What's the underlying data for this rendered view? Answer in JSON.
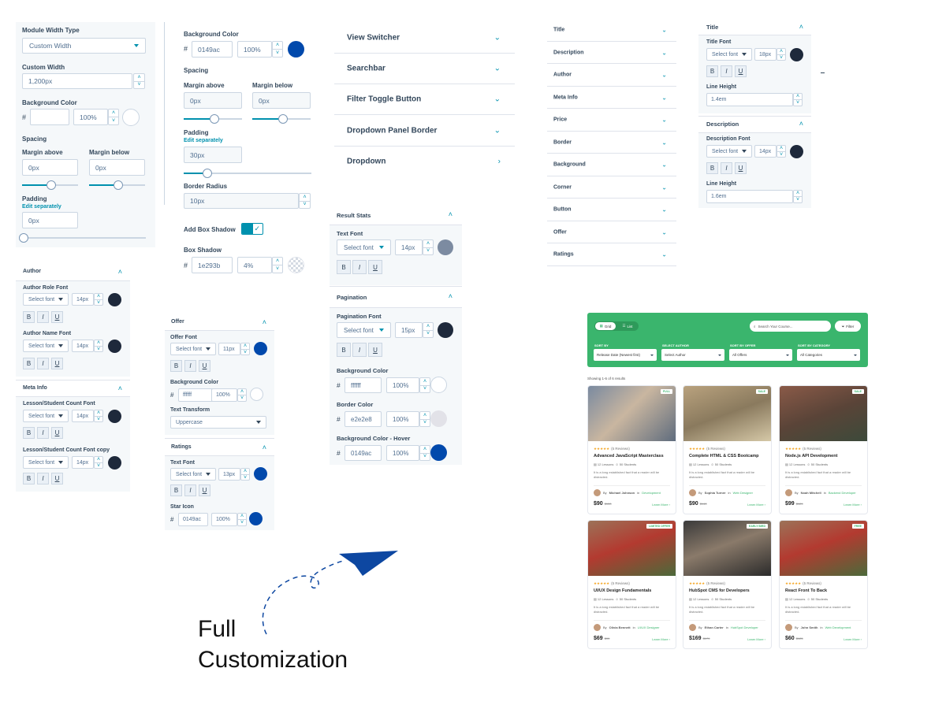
{
  "p1": {
    "module_width_type_label": "Module Width Type",
    "module_width_type_value": "Custom Width",
    "custom_width_label": "Custom Width",
    "custom_width_value": "1,200px",
    "bg_color_label": "Background Color",
    "bg_color_hash": "#",
    "bg_color_value": "",
    "bg_opacity": "100%",
    "spacing_label": "Spacing",
    "margin_above_label": "Margin above",
    "margin_above_value": "0px",
    "margin_below_label": "Margin below",
    "margin_below_value": "0px",
    "padding_label": "Padding",
    "edit_separately": "Edit separately",
    "padding_value": "0px"
  },
  "p2": {
    "bg_color_label": "Background Color",
    "bg_color_hash": "#",
    "bg_color_value": "0149ac",
    "bg_opacity": "100%",
    "spacing_label": "Spacing",
    "margin_above_label": "Margin above",
    "margin_above_value": "0px",
    "margin_below_label": "Margin below",
    "margin_below_value": "0px",
    "padding_label": "Padding",
    "edit_separately": "Edit separately",
    "padding_value": "30px",
    "border_radius_label": "Border Radius",
    "border_radius_value": "10px",
    "box_shadow_toggle_label": "Add Box Shadow",
    "box_shadow_label": "Box Shadow",
    "box_shadow_hash": "#",
    "box_shadow_value": "1e293b",
    "box_shadow_opacity": "4%"
  },
  "accordion": [
    {
      "label": "View Switcher",
      "chev": "⌄"
    },
    {
      "label": "Searchbar",
      "chev": "⌄"
    },
    {
      "label": "Filter Toggle Button",
      "chev": "⌄"
    },
    {
      "label": "Dropdown Panel Border",
      "chev": "⌄"
    },
    {
      "label": "Dropdown",
      "chev": "›"
    }
  ],
  "style_list": [
    "Title",
    "Description",
    "Author",
    "Meta Info",
    "Price",
    "Border",
    "Background",
    "Corner",
    "Button",
    "Offer",
    "Ratings"
  ],
  "title_panel": {
    "title_head": "Title",
    "title_font_label": "Title Font",
    "title_font_select": "Select font",
    "title_font_size": "18px",
    "line_height_label": "Line Height",
    "title_line_height": "1.4em",
    "desc_head": "Description",
    "desc_font_label": "Description Font",
    "desc_font_select": "Select font",
    "desc_font_size": "14px",
    "desc_line_height_label": "Line Height",
    "desc_line_height": "1.6em"
  },
  "author_panel": {
    "author_head": "Author",
    "role_font_label": "Author Role Font",
    "role_select": "Select font",
    "role_size": "14px",
    "name_font_label": "Author Name Font",
    "name_select": "Select font",
    "name_size": "14px",
    "meta_head": "Meta Info",
    "count_font_label": "Lesson/Student Count Font",
    "count_select": "Select font",
    "count_size": "14px",
    "count_copy_label": "Lesson/Student Count Font copy",
    "copy_select": "Select font",
    "copy_size": "14px"
  },
  "offer_panel": {
    "offer_head": "Offer",
    "offer_font_label": "Offer Font",
    "offer_select": "Select font",
    "offer_size": "11px",
    "bg_label": "Background Color",
    "bg_hash": "#",
    "bg_value": "ffffff",
    "bg_opacity": "100%",
    "transform_label": "Text Transform",
    "transform_value": "Uppercase",
    "ratings_head": "Ratings",
    "text_font_label": "Text Font",
    "ratings_select": "Select font",
    "ratings_size": "13px",
    "star_icon_label": "Star Icon",
    "star_hash": "#",
    "star_value": "0149ac",
    "star_opacity": "100%"
  },
  "result_panel": {
    "result_head": "Result Stats",
    "text_font_label": "Text Font",
    "result_select": "Select font",
    "result_size": "14px",
    "pagination_head": "Pagination",
    "pagination_font_label": "Pagination Font",
    "pagination_select": "Select font",
    "pagination_size": "15px",
    "bg_label": "Background Color",
    "bg_hash": "#",
    "bg_value": "ffffff",
    "bg_opacity": "100%",
    "border_label": "Border Color",
    "border_hash": "#",
    "border_value": "e2e2e8",
    "border_opacity": "100%",
    "hover_label": "Background Color - Hover",
    "hover_hash": "#",
    "hover_value": "0149ac",
    "hover_opacity": "100%"
  },
  "format_buttons": {
    "bold": "B",
    "italic": "I",
    "underline": "U"
  },
  "steppers": {
    "up": "˄",
    "down": "˅"
  },
  "collapse_chev": "˄",
  "list_chev": "⌄",
  "headline": {
    "line1": "Full",
    "line2": "Customization"
  },
  "course_ui": {
    "grid_label": "Grid",
    "list_label": "List",
    "search_placeholder": "Search Your Course...",
    "filter_label": "Filter",
    "sort_by_label": "SORT BY",
    "sort_by_value": "Release Date (Newest first)",
    "author_label": "SELECT AUTHOR",
    "author_value": "Select Author",
    "offer_label": "SORT BY OFFER",
    "offer_value": "All Offers",
    "category_label": "SORT BY CATEGORY",
    "category_value": "All Categories",
    "result_text": "Showing 1-6 of 6 results",
    "reviews": "(5 Reviews)",
    "stars": "★★★★★",
    "lessons": "12 Lessons",
    "students": "50 Students",
    "desc": "It is a long established fact that a reader will be distracted.",
    "by": "By",
    "in_word": "in",
    "learn_more": "Learn More ›",
    "cards": [
      {
        "badge": "FULL",
        "title": "Advanced JavaScript Masterclass",
        "author": "Michael Johnson",
        "category": "Development",
        "price": "$90",
        "old": "$150",
        "reviews": "(5 Reviews)"
      },
      {
        "badge": "SALE",
        "title": "Complete HTML & CSS Bootcamp",
        "author": "Sophia Turner",
        "category": "Web Designer",
        "price": "$90",
        "old": "$140",
        "reviews": "(5 Reviews)"
      },
      {
        "badge": "SALE",
        "title": "Node.js API Development",
        "author": "Noah Mitchell",
        "category": "Backend Developer",
        "price": "$99",
        "old": "$129",
        "reviews": "(5 Reviews)"
      },
      {
        "badge": "LIMITED OFFER",
        "title": "UI/UX Design Fundamentals",
        "author": "Olivia Bennett",
        "category": "UI/UX Designer",
        "price": "$69",
        "old": "$99",
        "reviews": "(5 Reviews)"
      },
      {
        "badge": "EARLY BIRD",
        "title": "HubSpot CMS for Developers",
        "author": "Ethan Carter",
        "category": "HubSpot Developer",
        "price": "$169",
        "old": "$179",
        "reviews": "(5 Reviews)"
      },
      {
        "badge": "FREE",
        "title": "React Front To Back",
        "author": "John Smith",
        "category": "Web Development",
        "price": "$60",
        "old": "$125",
        "reviews": "(5 Reviews)"
      }
    ]
  },
  "colors": {
    "accent": "#0091ae",
    "brand_blue": "#0149ac",
    "dark": "#1e293b",
    "green": "#3ab56d"
  }
}
